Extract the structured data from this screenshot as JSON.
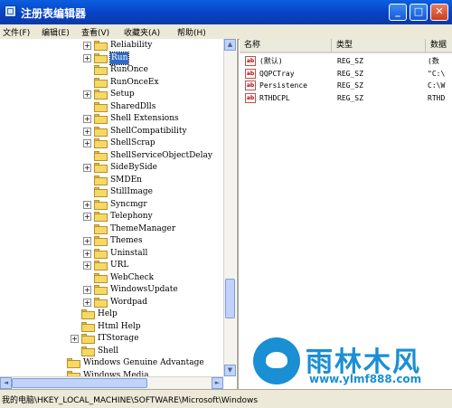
{
  "window": {
    "title": "注册表编辑器",
    "minimize_glyph": "_",
    "maximize_glyph": "□",
    "close_glyph": "✕"
  },
  "menu": [
    "文件(F)",
    "编辑(E)",
    "查看(V)",
    "收藏夹(A)",
    "帮助(H)"
  ],
  "tree": {
    "items": [
      {
        "label": "Reliability",
        "expander": "+",
        "level": 2
      },
      {
        "label": "Run",
        "expander": "+",
        "level": 2,
        "selected": true
      },
      {
        "label": "RunOnce",
        "expander": "",
        "level": 2
      },
      {
        "label": "RunOnceEx",
        "expander": "",
        "level": 2
      },
      {
        "label": "Setup",
        "expander": "+",
        "level": 2
      },
      {
        "label": "SharedDlls",
        "expander": "",
        "level": 2
      },
      {
        "label": "Shell Extensions",
        "expander": "+",
        "level": 2
      },
      {
        "label": "ShellCompatibility",
        "expander": "+",
        "level": 2
      },
      {
        "label": "ShellScrap",
        "expander": "+",
        "level": 2
      },
      {
        "label": "ShellServiceObjectDelay",
        "expander": "",
        "level": 2
      },
      {
        "label": "SideBySide",
        "expander": "+",
        "level": 2
      },
      {
        "label": "SMDEn",
        "expander": "",
        "level": 2
      },
      {
        "label": "StillImage",
        "expander": "",
        "level": 2
      },
      {
        "label": "Syncmgr",
        "expander": "+",
        "level": 2
      },
      {
        "label": "Telephony",
        "expander": "+",
        "level": 2
      },
      {
        "label": "ThemeManager",
        "expander": "",
        "level": 2
      },
      {
        "label": "Themes",
        "expander": "+",
        "level": 2
      },
      {
        "label": "Uninstall",
        "expander": "+",
        "level": 2
      },
      {
        "label": "URL",
        "expander": "+",
        "level": 2
      },
      {
        "label": "WebCheck",
        "expander": "",
        "level": 2
      },
      {
        "label": "WindowsUpdate",
        "expander": "+",
        "level": 2
      },
      {
        "label": "Wordpad",
        "expander": "+",
        "level": 2
      },
      {
        "label": "Help",
        "expander": "",
        "level": 1
      },
      {
        "label": "Html Help",
        "expander": "",
        "level": 1
      },
      {
        "label": "ITStorage",
        "expander": "+",
        "level": 1
      },
      {
        "label": "Shell",
        "expander": "",
        "level": 1
      },
      {
        "label": "Windows Genuine Advantage",
        "expander": "",
        "level": 0
      },
      {
        "label": "Windows Media",
        "expander": "",
        "level": 0
      }
    ]
  },
  "scrollbar": {
    "up": "▲",
    "down": "▼",
    "left": "◄",
    "right": "►"
  },
  "list": {
    "columns": [
      "名称",
      "类型",
      "数据"
    ],
    "rows": [
      {
        "name": "(默认)",
        "type": "REG_SZ",
        "data": "(数"
      },
      {
        "name": "QQPCTray",
        "type": "REG_SZ",
        "data": "\"C:\\"
      },
      {
        "name": "Persistence",
        "type": "REG_SZ",
        "data": "C:\\W"
      },
      {
        "name": "RTHDCPL",
        "type": "REG_SZ",
        "data": "RTHD"
      }
    ],
    "icon_text": "ab"
  },
  "status": {
    "path": "我的电脑\\HKEY_LOCAL_MACHINE\\SOFTWARE\\Microsoft\\Windows"
  },
  "watermark": {
    "name": "雨林木风",
    "url": "www.ylmf888.com"
  },
  "colors": {
    "titlebar": "#0a5fe0",
    "selection": "#316ac5",
    "folder": "#f6d965",
    "watermark": "#1a8fd3"
  }
}
